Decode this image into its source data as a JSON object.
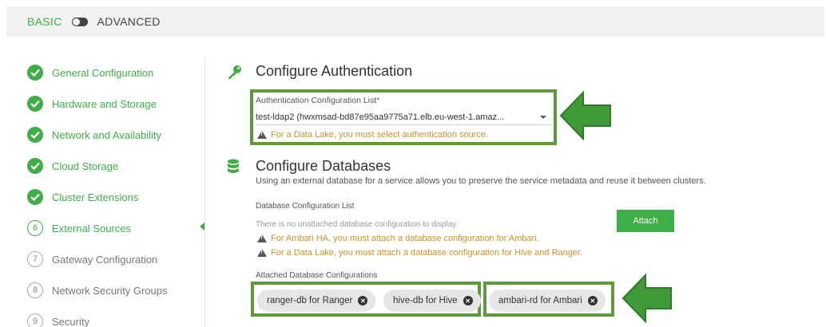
{
  "mode": {
    "basic": "BASIC",
    "advanced": "ADVANCED"
  },
  "steps": [
    {
      "label": "General Configuration",
      "state": "done"
    },
    {
      "label": "Hardware and Storage",
      "state": "done"
    },
    {
      "label": "Network and Availability",
      "state": "done"
    },
    {
      "label": "Cloud Storage",
      "state": "done"
    },
    {
      "label": "Cluster Extensions",
      "state": "done"
    },
    {
      "label": "External Sources",
      "number": "6",
      "state": "active"
    },
    {
      "label": "Gateway Configuration",
      "number": "7",
      "state": "pending"
    },
    {
      "label": "Network Security Groups",
      "number": "8",
      "state": "pending"
    },
    {
      "label": "Security",
      "number": "9",
      "state": "pending"
    }
  ],
  "auth": {
    "title": "Configure Authentication",
    "list_label": "Authentication Configuration List",
    "required_mark": "*",
    "selected": "test-ldap2 (hwxmsad-bd87e95aa9775a71.elb.eu-west-1.amaz...",
    "warning": "For a Data Lake, you must select authentication source."
  },
  "db": {
    "title": "Configure Databases",
    "description": "Using an external database for a service allows you to preserve the service metadata and reuse it between clusters.",
    "list_label": "Database Configuration List",
    "empty_text": "There is no unattached database configuration to display.",
    "attach_label": "Attach",
    "warning_ambari": "For Ambari HA, you must attach a database configuration for Ambari.",
    "warning_datalake": "For a Data Lake, you must attach a database configuration for Hive and Ranger.",
    "attached_label": "Attached Database Configurations",
    "chips": [
      "ranger-db for Ranger",
      "hive-db for Hive",
      "ambari-rd for Ambari"
    ]
  },
  "colors": {
    "accent": "#3fae49",
    "highlight": "#5f9a3a",
    "warning": "#c8922a"
  },
  "icons": {
    "auth": "key-icon",
    "db": "database-icon",
    "callout": "arrow-left-icon"
  }
}
